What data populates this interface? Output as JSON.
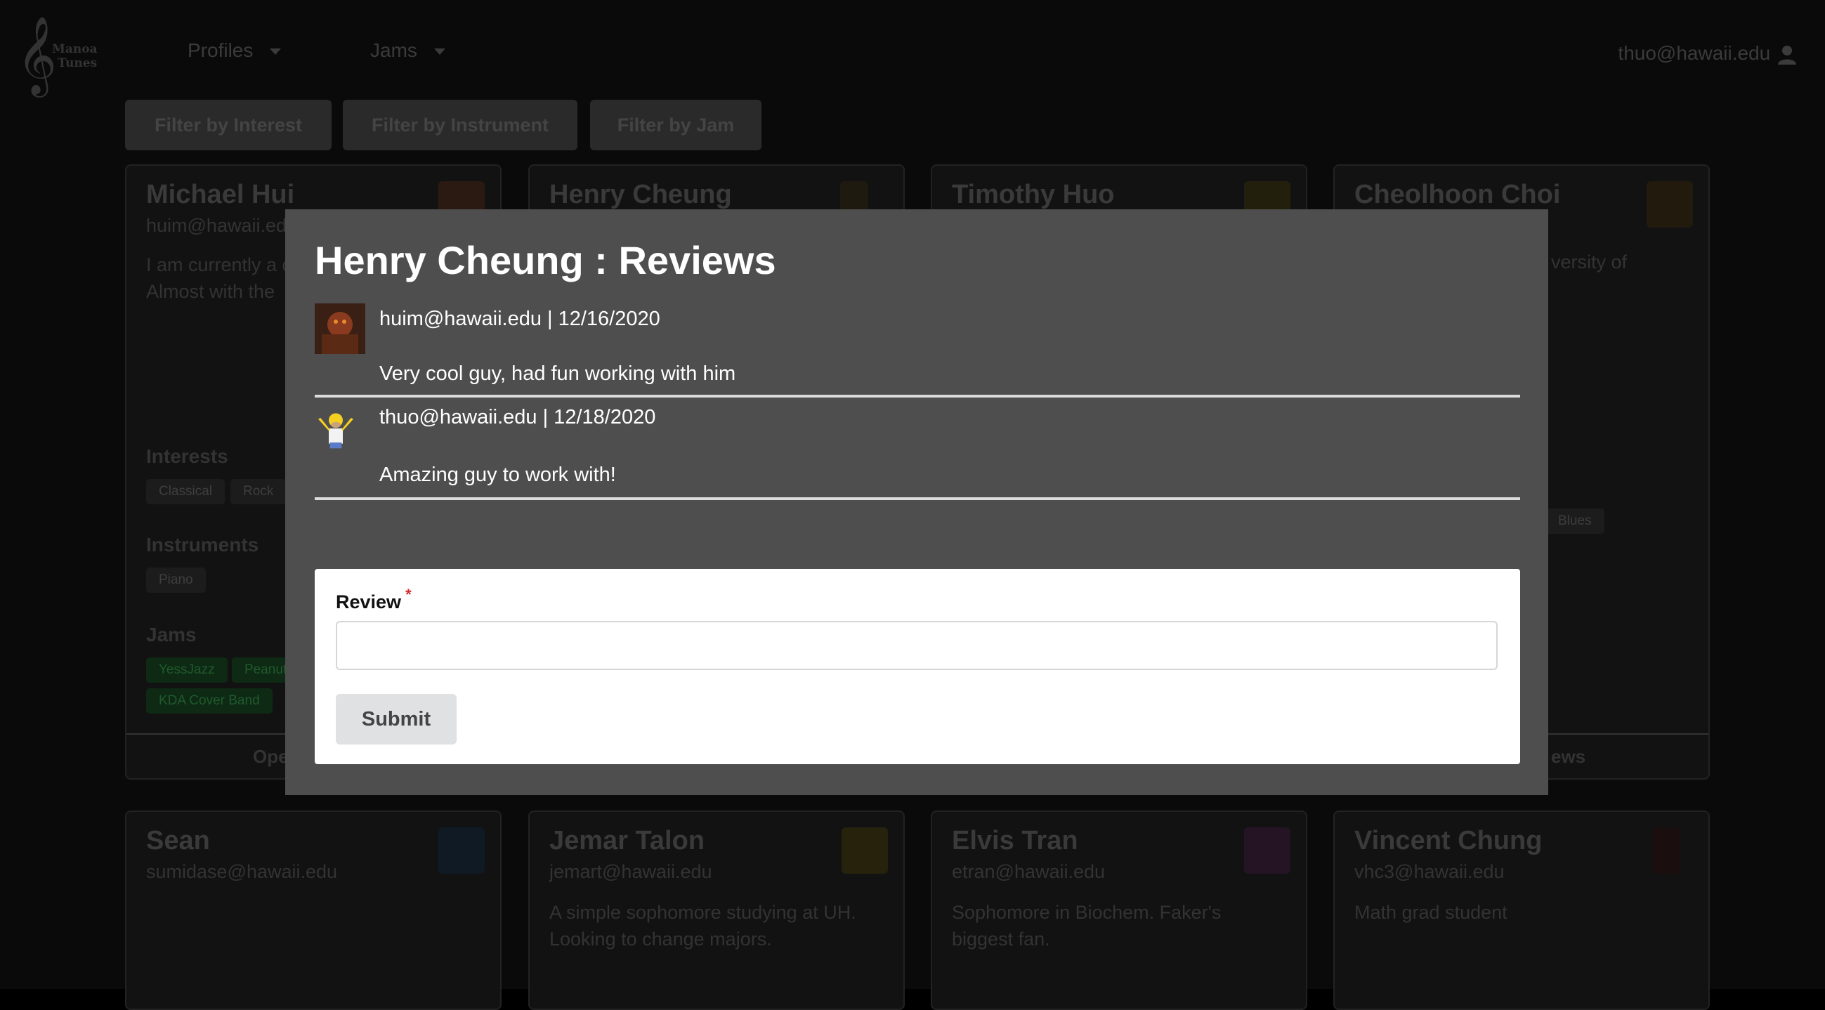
{
  "navbar": {
    "logo_line1": "Manoa",
    "logo_line2": "Tunes",
    "menu_profiles": "Profiles",
    "menu_jams": "Jams",
    "user_email": "thuo@hawaii.edu"
  },
  "filters": {
    "interest": "Filter by Interest",
    "instrument": "Filter by Instrument",
    "jam": "Filter by Jam"
  },
  "cards_row1": [
    {
      "name": "Michael Hui",
      "email": "huim@hawaii.ed",
      "bio": "I am currently a computer scienc Almost with the",
      "interests_heading": "Interests",
      "interests": [
        "Classical",
        "Rock"
      ],
      "instruments_heading": "Instruments",
      "instruments": [
        "Piano"
      ],
      "jams_heading": "Jams",
      "jams": [
        "YessJazz",
        "Peanut",
        "KDA Cover Band"
      ],
      "footer": "Ope"
    },
    {
      "name": "Henry Cheung"
    },
    {
      "name": "Timothy Huo"
    },
    {
      "name": "Cheolhoon Choi",
      "bio_fragment": "versity of",
      "tag_fragment": "Blues",
      "footer": "ews"
    }
  ],
  "cards_row2": [
    {
      "name": "Sean",
      "email": "sumidase@hawaii.edu",
      "bio": ""
    },
    {
      "name": "Jemar Talon",
      "email": "jemart@hawaii.edu",
      "bio": "A simple sophomore studying at UH. Looking to change majors."
    },
    {
      "name": "Elvis Tran",
      "email": "etran@hawaii.edu",
      "bio": "Sophomore in Biochem. Faker's biggest fan."
    },
    {
      "name": "Vincent Chung",
      "email": "vhc3@hawaii.edu",
      "bio": "Math grad student"
    }
  ],
  "modal": {
    "title": "Henry Cheung : Reviews",
    "reviews": [
      {
        "meta": "huim@hawaii.edu | 12/16/2020",
        "text": "Very cool guy, had fun working with him"
      },
      {
        "meta": "thuo@hawaii.edu | 12/18/2020",
        "text": "Amazing guy to work with!"
      }
    ],
    "form": {
      "label": "Review",
      "required_mark": "*",
      "input_value": "",
      "submit_label": "Submit"
    }
  }
}
